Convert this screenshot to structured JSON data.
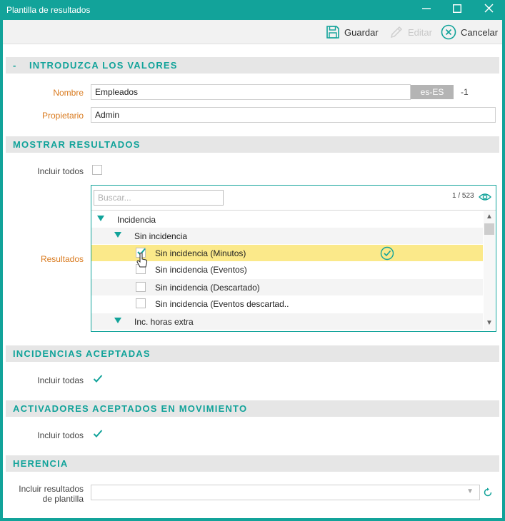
{
  "window": {
    "title": "Plantilla de resultados",
    "accent": "#12a39a"
  },
  "toolbar": {
    "save_label": "Guardar",
    "edit_label": "Editar",
    "cancel_label": "Cancelar"
  },
  "sections": {
    "values": {
      "toggle": "-",
      "title": "INTRODUZCA LOS VALORES"
    },
    "show_results": {
      "title": "MOSTRAR RESULTADOS"
    },
    "accepted_incidences": {
      "title": "INCIDENCIAS ACEPTADAS"
    },
    "accepted_triggers": {
      "title": "ACTIVADORES ACEPTADOS EN MOVIMIENTO"
    },
    "inheritance": {
      "title": "HERENCIA"
    }
  },
  "form": {
    "name_label": "Nombre",
    "name_value": "Empleados",
    "language_badge": "es-ES",
    "name_suffix": "-1",
    "owner_label": "Propietario",
    "owner_value": "Admin",
    "include_all_results_label": "Incluir todos",
    "results_label": "Resultados",
    "include_all_incidences_label": "Incluir todas",
    "include_all_triggers_label": "Incluir todos",
    "include_template_results_label_line1": "Incluir resultados",
    "include_template_results_label_line2": "de plantilla"
  },
  "results_panel": {
    "search_placeholder": "Buscar...",
    "count": "1 / 523",
    "rows": [
      {
        "label": "Incidencia",
        "type": "group",
        "level": 0
      },
      {
        "label": "Sin incidencia",
        "type": "group",
        "level": 1
      },
      {
        "label": "Sin incidencia (Minutos)",
        "type": "item",
        "checked": true,
        "selected": true
      },
      {
        "label": "Sin incidencia (Eventos)",
        "type": "item",
        "checked": false
      },
      {
        "label": "Sin incidencia (Descartado)",
        "type": "item",
        "checked": false
      },
      {
        "label": "Sin incidencia (Eventos descartad..",
        "type": "item",
        "checked": false
      },
      {
        "label": "Inc. horas extra",
        "type": "group",
        "level": 1
      }
    ]
  },
  "checks": {
    "include_all_results": false,
    "include_all_incidences": true,
    "include_all_triggers": true
  }
}
